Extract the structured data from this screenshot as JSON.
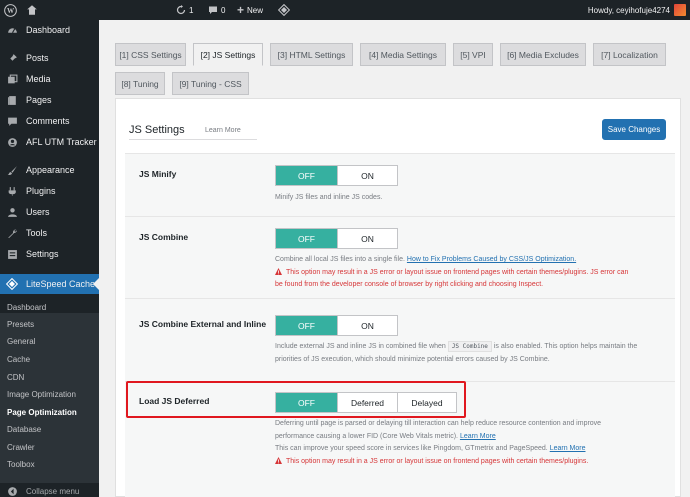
{
  "adminbar": {
    "updates_count": "1",
    "comments_count": "0",
    "new_label": "New",
    "howdy": "Howdy, ceyihofuje4274"
  },
  "sidebar": {
    "items": [
      {
        "label": "Dashboard",
        "icon": "dashboard-icon"
      },
      {
        "label": "Posts",
        "icon": "pin-icon"
      },
      {
        "label": "Media",
        "icon": "media-icon"
      },
      {
        "label": "Pages",
        "icon": "pages-icon"
      },
      {
        "label": "Comments",
        "icon": "comments-icon"
      },
      {
        "label": "AFL UTM Tracker",
        "icon": "tracker-icon"
      },
      {
        "label": "Appearance",
        "icon": "brush-icon"
      },
      {
        "label": "Plugins",
        "icon": "plugin-icon"
      },
      {
        "label": "Users",
        "icon": "user-icon"
      },
      {
        "label": "Tools",
        "icon": "wrench-icon"
      },
      {
        "label": "Settings",
        "icon": "settings-icon"
      },
      {
        "label": "LiteSpeed Cache",
        "icon": "litespeed-icon"
      }
    ],
    "submenu": [
      "Dashboard",
      "Presets",
      "General",
      "Cache",
      "CDN",
      "Image Optimization",
      "Page Optimization",
      "Database",
      "Crawler",
      "Toolbox"
    ],
    "collapse_label": "Collapse menu"
  },
  "tabs": [
    "[1] CSS Settings",
    "[2] JS Settings",
    "[3] HTML Settings",
    "[4] Media Settings",
    "[5] VPI",
    "[6] Media Excludes",
    "[7] Localization",
    "[8] Tuning",
    "[9] Tuning - CSS"
  ],
  "panel": {
    "title": "JS Settings",
    "learn_more": "Learn More",
    "save_label": "Save Changes"
  },
  "settings": {
    "minify": {
      "label": "JS Minify",
      "options": [
        "OFF",
        "ON"
      ],
      "desc": "Minify JS files and inline JS codes."
    },
    "combine": {
      "label": "JS Combine",
      "options": [
        "OFF",
        "ON"
      ],
      "desc": "Combine all local JS files into a single file.",
      "link": "How to Fix Problems Caused by CSS/JS Optimization.",
      "warning_line1": "This option may result in a JS error or layout issue on frontend pages with certain themes/plugins. JS error can",
      "warning_line2": "be found from the developer console of browser by right clicking and choosing Inspect."
    },
    "combine_external": {
      "label": "JS Combine External and Inline",
      "options": [
        "OFF",
        "ON"
      ],
      "desc_part1": "Include external JS and inline JS in combined file when",
      "code": "JS Combine",
      "desc_part2": "is also enabled. This option helps maintain the",
      "desc_line2": "priorities of JS execution, which should minimize potential errors caused by JS Combine."
    },
    "deferred": {
      "label": "Load JS Deferred",
      "options": [
        "OFF",
        "Deferred",
        "Delayed"
      ],
      "desc_line1": "Deferring until page is parsed or delaying till interaction can help reduce resource contention and improve",
      "desc_line2": "performance causing a lower FID (Core Web Vitals metric).",
      "link1": "Learn More",
      "desc_line3": "This can improve your speed score in services like Pingdom, GTmetrix and PageSpeed.",
      "link2": "Learn More",
      "warning": "This option may result in a JS error or layout issue on frontend pages with certain themes/plugins."
    }
  },
  "colors": {
    "accent": "#2271b1",
    "toggle_on": "#36b0a0",
    "warning": "#d63638",
    "highlight": "#e0181f"
  }
}
